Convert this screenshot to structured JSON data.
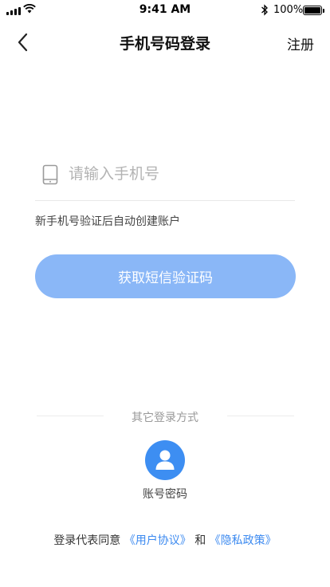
{
  "status_bar": {
    "time": "9:41 AM",
    "battery": "100%"
  },
  "nav": {
    "title": "手机号码登录",
    "register": "注册"
  },
  "phone": {
    "placeholder": "请输入手机号",
    "value": "",
    "hint": "新手机号验证后自动创建账户"
  },
  "action": {
    "get_code": "获取短信验证码"
  },
  "other_login": {
    "title": "其它登录方式",
    "account_password": "账号密码"
  },
  "agreement": {
    "prefix": "登录代表同意",
    "user_agreement": "《用户协议》",
    "and": "和",
    "privacy_policy": "《隐私政策》"
  },
  "colors": {
    "primary_button": "#8ab7f7",
    "accent": "#3d8ef2",
    "link": "#3c8af0"
  },
  "icons": [
    "signal-icon",
    "wifi-icon",
    "bluetooth-icon",
    "battery-icon",
    "back-chevron-icon",
    "phone-icon",
    "user-icon"
  ]
}
